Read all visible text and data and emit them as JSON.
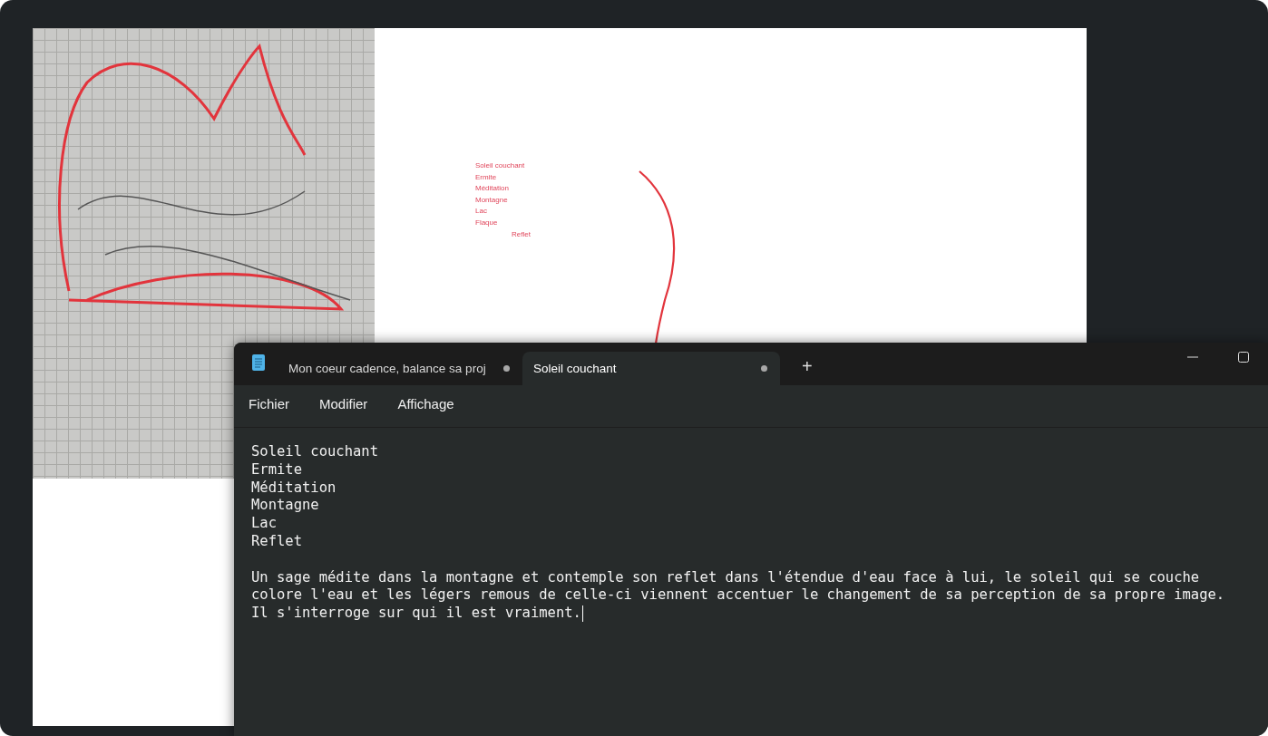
{
  "canvas_notes": [
    "Soleil couchant",
    "Ermite",
    "Méditation",
    "Montagne",
    "Lac",
    "Flaque"
  ],
  "canvas_note_offset": "Reflet",
  "notepad": {
    "tabs": [
      {
        "title": "Mon coeur cadence, balance sa proj",
        "selected": false,
        "unsaved": true
      },
      {
        "title": "Soleil couchant",
        "selected": true,
        "unsaved": true
      }
    ],
    "new_tab": "+",
    "menu": [
      "Fichier",
      "Modifier",
      "Affichage"
    ],
    "lines": [
      "Soleil couchant",
      "Ermite",
      "Méditation",
      "Montagne",
      "Lac",
      "Reflet"
    ],
    "paragraph": [
      "Un sage médite dans la montagne et contemple son reflet dans l'étendue d'eau face à lui, le soleil qui se couche",
      "colore l'eau et les légers remous de celle-ci viennent accentuer le changement de sa perception de sa propre image.",
      "Il s'interroge sur qui il est vraiment."
    ]
  }
}
